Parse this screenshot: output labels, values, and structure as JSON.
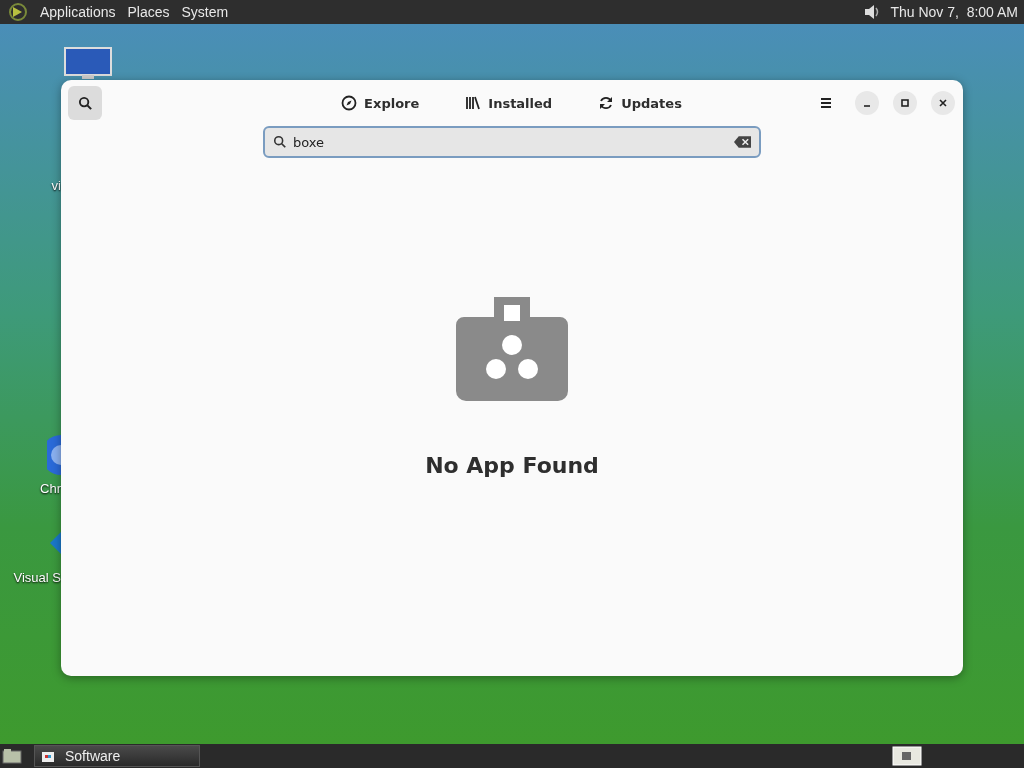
{
  "top_panel": {
    "menus": [
      "Applications",
      "Places",
      "System"
    ],
    "clock": "Thu Nov 7,  8:00 AM"
  },
  "desktop_icons": [
    {
      "kind": "monitor",
      "label": "vi"
    },
    {
      "kind": "browser",
      "label": "Chr"
    },
    {
      "kind": "editor",
      "label": "Visual S"
    }
  ],
  "window": {
    "search_toggle": {
      "on": true
    },
    "tabs": [
      {
        "kind": "explore",
        "label": "Explore",
        "selected": false
      },
      {
        "kind": "installed",
        "label": "Installed",
        "selected": false
      },
      {
        "kind": "updates",
        "label": "Updates",
        "selected": false
      }
    ],
    "search": {
      "value": "boxe"
    },
    "empty_state": {
      "title": "No App Found"
    }
  },
  "taskbar": {
    "tasks": [
      {
        "label": "Software",
        "selected": false
      }
    ]
  }
}
